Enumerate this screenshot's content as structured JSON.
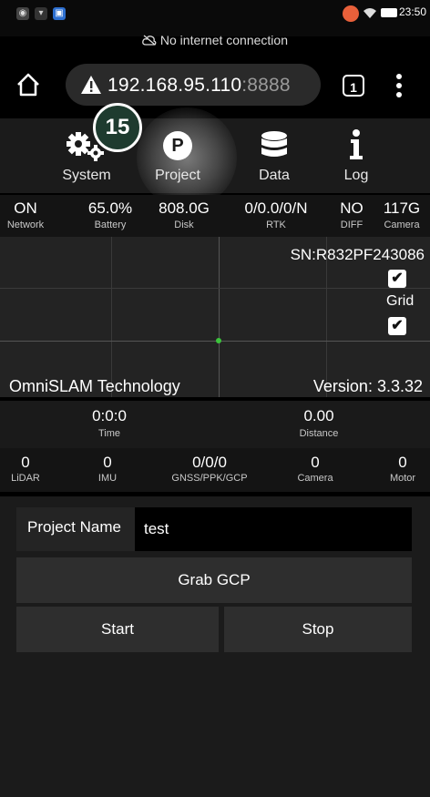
{
  "status_bar": {
    "time": "23:50"
  },
  "network_notice": "No internet connection",
  "browser": {
    "url_host": "192.168.95.110",
    "url_port": ":8888",
    "tab_count": "1"
  },
  "badge": "15",
  "nav": {
    "items": [
      {
        "label": "System",
        "icon": "gears-icon"
      },
      {
        "label": "Project",
        "icon": "project-p-icon"
      },
      {
        "label": "Data",
        "icon": "database-icon"
      },
      {
        "label": "Log",
        "icon": "info-icon"
      }
    ]
  },
  "metrics": [
    {
      "value": "ON",
      "label": "Network"
    },
    {
      "value": "65.0%",
      "label": "Battery"
    },
    {
      "value": "808.0G",
      "label": "Disk"
    },
    {
      "value": "0/0.0/0/N",
      "label": "RTK"
    },
    {
      "value": "NO",
      "label": "DIFF"
    },
    {
      "value": "117G",
      "label": "Camera"
    }
  ],
  "map": {
    "serial": "SN:R832PF243086",
    "grid_label": "Grid",
    "checkbox1_checked": true,
    "checkbox2_checked": true
  },
  "info": {
    "company": "OmniSLAM Technology",
    "version": "Version: 3.3.32"
  },
  "stats": [
    {
      "value": "0:0:0",
      "label": "Time"
    },
    {
      "value": "0.00",
      "label": "Distance"
    }
  ],
  "sensors": [
    {
      "value": "0",
      "label": "LiDAR"
    },
    {
      "value": "0",
      "label": "IMU"
    },
    {
      "value": "0/0/0",
      "label": "GNSS/PPK/GCP"
    },
    {
      "value": "0",
      "label": "Camera"
    },
    {
      "value": "0",
      "label": "Motor"
    }
  ],
  "form": {
    "project_name_label": "Project Name",
    "project_name_value": "test",
    "grab_gcp_label": "Grab GCP",
    "start_label": "Start",
    "stop_label": "Stop"
  },
  "colors": {
    "background": "#000000",
    "panel": "#1b1b1b",
    "button": "#2e2e2e",
    "badge": "#1e3b2f",
    "crosshair_dot": "#3cc43c"
  }
}
